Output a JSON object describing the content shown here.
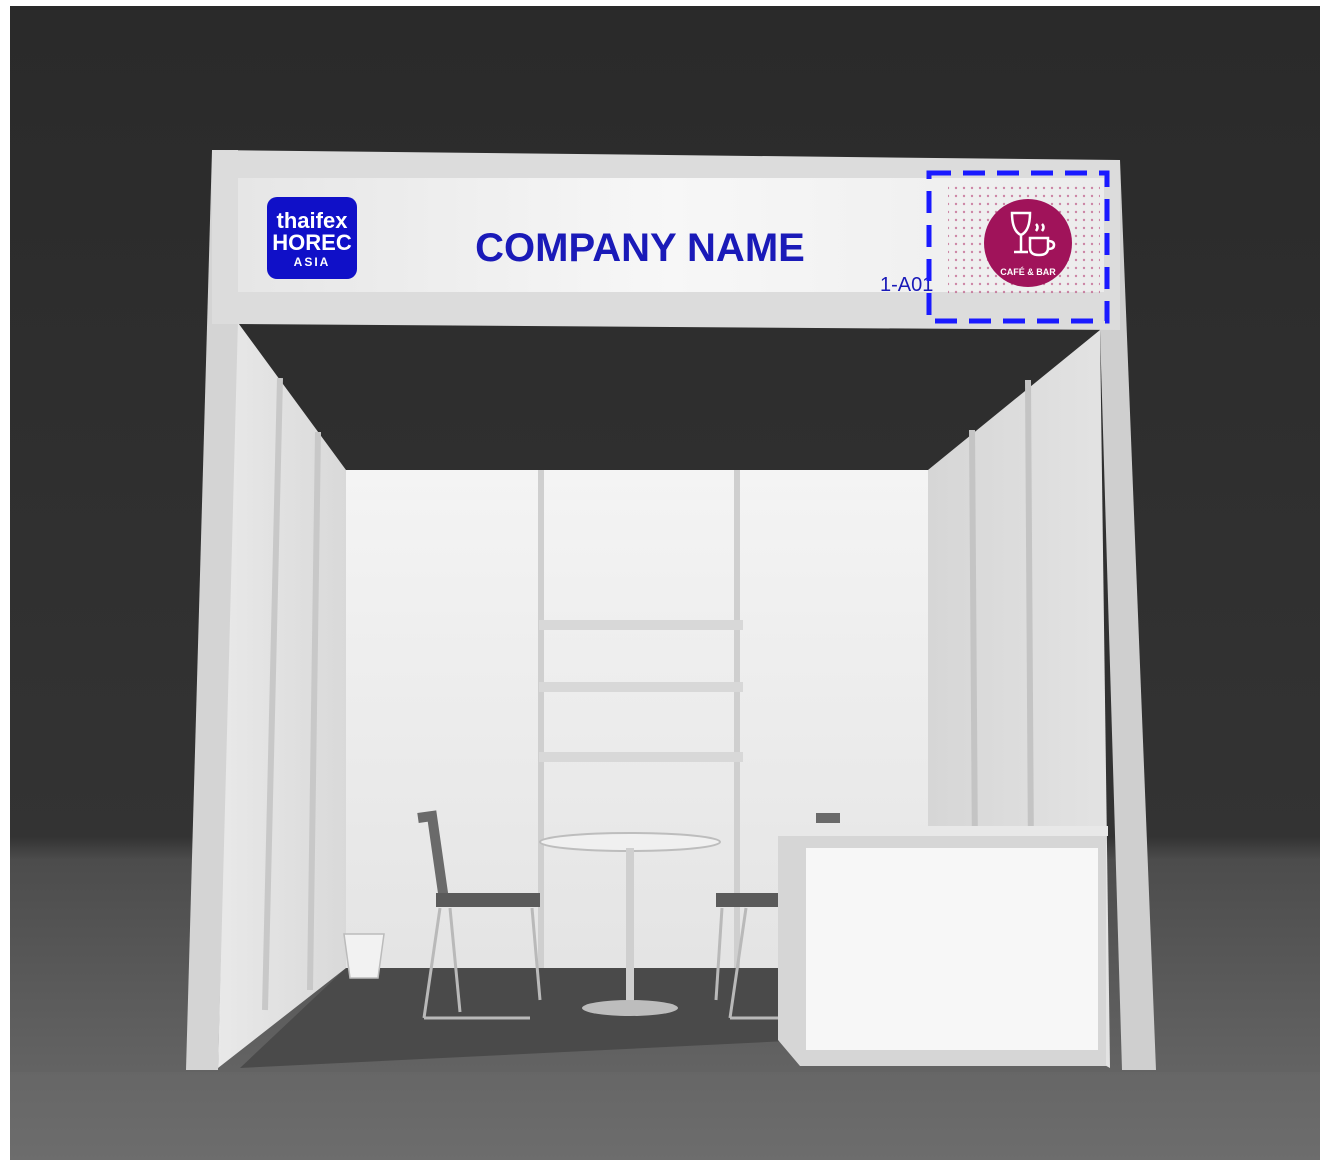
{
  "booth": {
    "company_name": "COMPANY NAME",
    "booth_number": "1-A01"
  },
  "logos": {
    "event_logo": [
      "thaifex",
      "HOREC",
      "ASIA"
    ],
    "zone_logo": "CAFÉ & BAR"
  },
  "colors": {
    "backdrop": "#2b2b2b",
    "floor": "#5a5a5a",
    "fascia": "#f2f2f2",
    "brand_blue": "#1010c8",
    "zone_magenta": "#a0135a",
    "highlight_dash": "#1a1aff"
  }
}
